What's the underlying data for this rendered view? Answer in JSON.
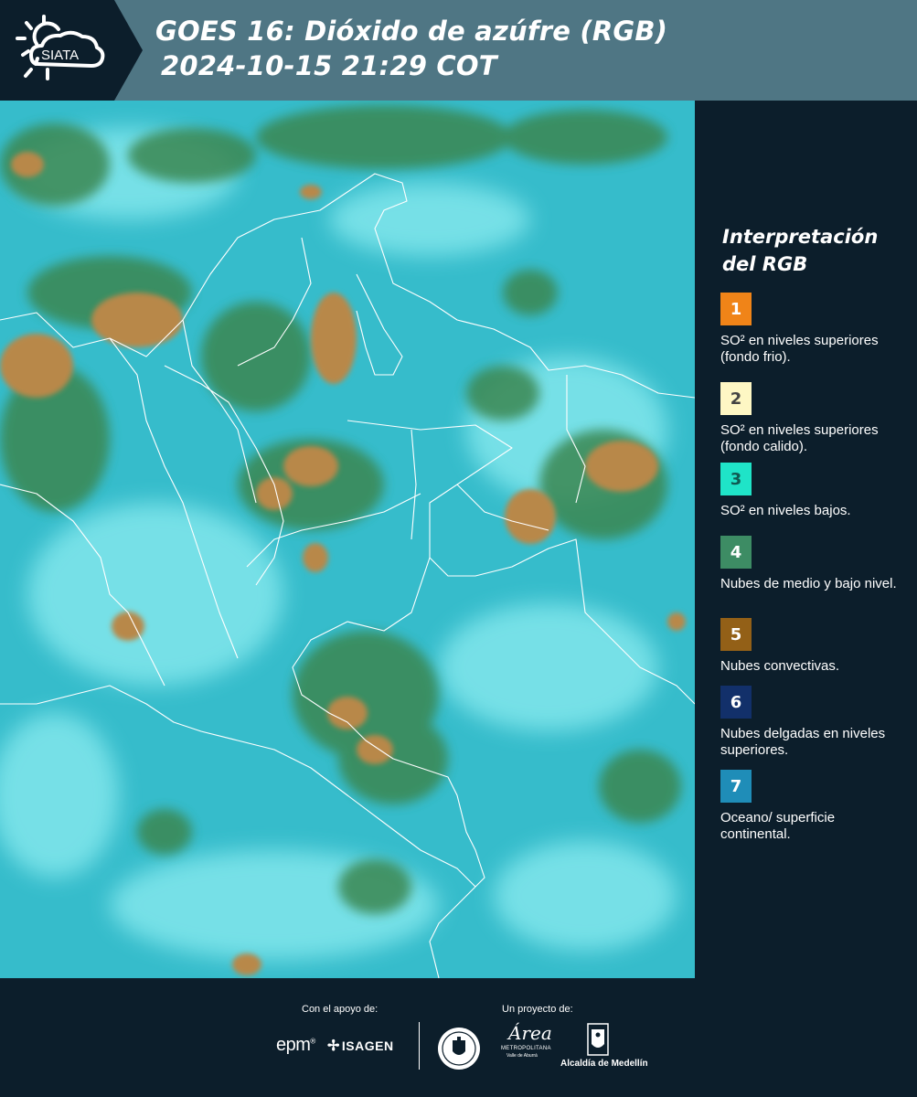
{
  "header": {
    "logo_text": "SIATA",
    "title_line1": "GOES 16: Dióxido de azúfre (RGB)",
    "title_line2": "2024-10-15 21:29 COT",
    "background_color": "#4f7684",
    "logo_panel_color": "#0c1e2b"
  },
  "map": {
    "description_icon": "satellite-rgb-map",
    "cloud_colors": {
      "ocean_surface": "#39c4d2",
      "low_clouds": "#3d8a55",
      "convective": "#b48a45",
      "high_thin": "#7fe6ea"
    }
  },
  "legend": {
    "title": "Interpretación del RGB",
    "items": [
      {
        "number": "1",
        "color": "#f08418",
        "text_color": "#ffffff",
        "label": "SO² en niveles superiores (fondo frio)."
      },
      {
        "number": "2",
        "color": "#fef7c4",
        "text_color": "#444444",
        "label": "SO² en niveles superiores (fondo calido)."
      },
      {
        "number": "3",
        "color": "#1fe4c8",
        "text_color": "#0f5a52",
        "label": "SO² en niveles bajos."
      },
      {
        "number": "4",
        "color": "#3d8c64",
        "text_color": "#ffffff",
        "label": "Nubes de medio y bajo nivel."
      },
      {
        "number": "5",
        "color": "#936017",
        "text_color": "#ffffff",
        "label": "Nubes convectivas."
      },
      {
        "number": "6",
        "color": "#12306a",
        "text_color": "#ffffff",
        "label": "Nubes delgadas en niveles superiores."
      },
      {
        "number": "7",
        "color": "#1f8db8",
        "text_color": "#ffffff",
        "label": "Oceano/ superficie continental."
      }
    ]
  },
  "footer": {
    "support_heading": "Con el apoyo de:",
    "project_heading": "Un proyecto de:",
    "epm_text": "epm",
    "isagen_text": "ISAGEN",
    "area_script": "Área",
    "area_line1": "METROPOLITANA",
    "area_line2": "Valle de Aburrá",
    "alcaldia_text": "Alcaldía de Medellín"
  }
}
